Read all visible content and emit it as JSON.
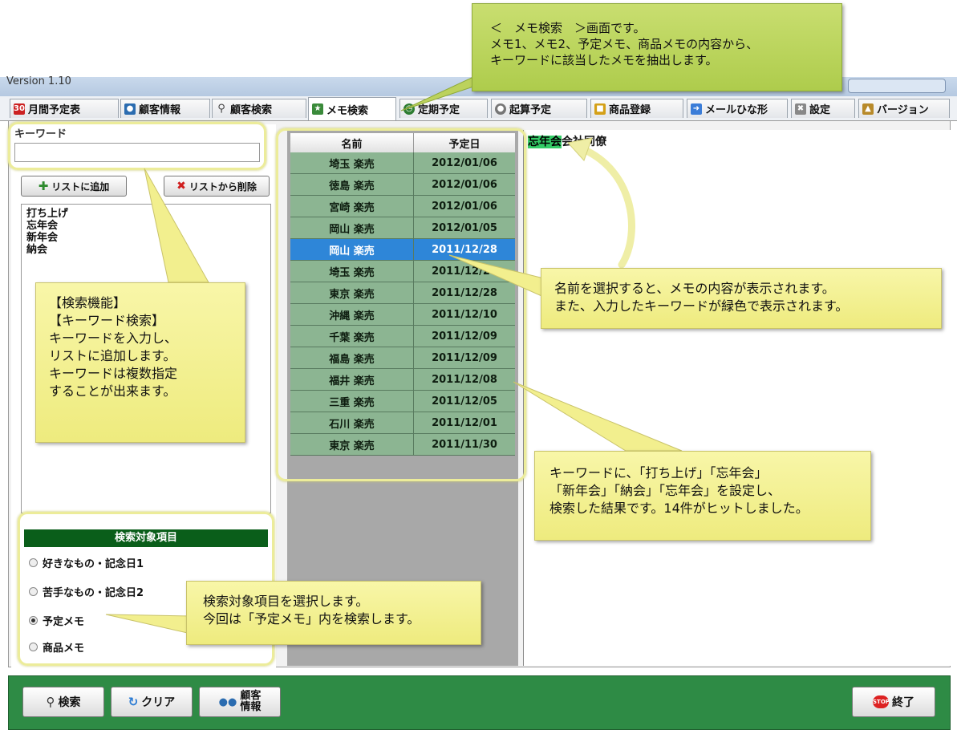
{
  "window": {
    "title": "Version 1.10"
  },
  "tabs": [
    {
      "label": "月間予定表",
      "icon": "calendar-icon",
      "color": "#cc2222"
    },
    {
      "label": "顧客情報",
      "icon": "people-icon",
      "color": "#2b6cb0"
    },
    {
      "label": "顧客検索",
      "icon": "magnifier-icon",
      "color": "#555555"
    },
    {
      "label": "メモ検索",
      "icon": "memo-person-icon",
      "color": "#3a8a3a"
    },
    {
      "label": "定期予定",
      "icon": "clock-icon",
      "color": "#2e7d32"
    },
    {
      "label": "起算予定",
      "icon": "start-icon",
      "color": "#777777"
    },
    {
      "label": "商品登録",
      "icon": "gift-icon",
      "color": "#d4a017"
    },
    {
      "label": "メールひな形",
      "icon": "mail-arrow-icon",
      "color": "#3b7dd8"
    },
    {
      "label": "設定",
      "icon": "tools-icon",
      "color": "#888888"
    },
    {
      "label": "バージョン",
      "icon": "version-icon",
      "color": "#b88a2a"
    }
  ],
  "search": {
    "keyword_label": "キーワード",
    "keyword_value": "",
    "add_button": "リストに追加",
    "remove_button": "リストから削除",
    "keywords": [
      "打ち上げ",
      "忘年会",
      "新年会",
      "納会"
    ]
  },
  "target": {
    "title": "検索対象項目",
    "options": [
      "好きなもの・記念日1",
      "苦手なもの・記念日2",
      "予定メモ",
      "商品メモ"
    ],
    "selected": "予定メモ"
  },
  "grid": {
    "columns": [
      "名前",
      "予定日"
    ],
    "rows": [
      [
        "埼玉 楽売",
        "2012/01/06"
      ],
      [
        "徳島 楽売",
        "2012/01/06"
      ],
      [
        "宮崎 楽売",
        "2012/01/06"
      ],
      [
        "岡山 楽売",
        "2012/01/05"
      ],
      [
        "岡山 楽売",
        "2011/12/28"
      ],
      [
        "埼玉 楽売",
        "2011/12/28"
      ],
      [
        "東京 楽売",
        "2011/12/28"
      ],
      [
        "沖縄 楽売",
        "2011/12/10"
      ],
      [
        "千葉 楽売",
        "2011/12/09"
      ],
      [
        "福島 楽売",
        "2011/12/09"
      ],
      [
        "福井 楽売",
        "2011/12/08"
      ],
      [
        "三重 楽売",
        "2011/12/05"
      ],
      [
        "石川 楽売",
        "2011/12/01"
      ],
      [
        "東京 楽売",
        "2011/11/30"
      ]
    ],
    "selected_index": 4
  },
  "memo": {
    "highlight": "忘年会",
    "rest": "会社同僚"
  },
  "bottom": {
    "search": "検索",
    "clear": "クリア",
    "customer_line1": "顧客",
    "customer_line2": "情報",
    "exit": "終了"
  },
  "callouts": {
    "top": [
      "＜　メモ検索　＞画面です。",
      "メモ1、メモ2、予定メモ、商品メモの内容から、",
      "キーワードに該当したメモを抽出します。"
    ],
    "left": [
      "【検索機能】",
      "【キーワード検索】",
      "キーワードを入力し、",
      "リストに追加します。",
      "キーワードは複数指定",
      "することが出来ます。"
    ],
    "select": [
      "名前を選択すると、メモの内容が表示されます。",
      "また、入力したキーワードが緑色で表示されます。"
    ],
    "result": [
      "キーワードに、「打ち上げ」「忘年会」",
      "「新年会」「納会」「忘年会」を設定し、",
      "検索した結果です。14件がヒットしました。"
    ],
    "target": [
      "検索対象項目を選択します。",
      "今回は「予定メモ」内を検索します。"
    ]
  }
}
